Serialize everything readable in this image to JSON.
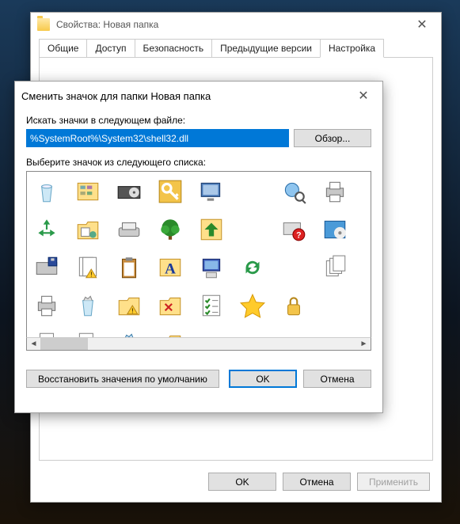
{
  "props": {
    "title": "Свойства: Новая папка",
    "tabs": [
      "Общие",
      "Доступ",
      "Безопасность",
      "Предыдущие версии",
      "Настройка"
    ],
    "active_tab": 4,
    "buttons": {
      "ok": "OK",
      "cancel": "Отмена",
      "apply": "Применить"
    }
  },
  "dlg": {
    "title": "Сменить значок для папки Новая папка",
    "path_label": "Искать значки в следующем файле:",
    "path_value": "%SystemRoot%\\System32\\shell32.dll",
    "browse": "Обзор...",
    "list_label": "Выберите значок из следующего списка:",
    "buttons": {
      "restore": "Восстановить значения по умолчанию",
      "ok": "OK",
      "cancel": "Отмена"
    }
  },
  "icons": [
    "recycle-bin-empty",
    "control-panel",
    "cd-drive",
    "key",
    "display-settings",
    "blank",
    "network-search",
    "printer",
    "recycle-arrows",
    "setup-folder",
    "scanner",
    "tree",
    "arrow-up",
    "blank",
    "help-settings",
    "programs-disc",
    "floppy-drive",
    "document-warning",
    "clipboard",
    "font-a",
    "computer-desktop",
    "refresh-arrows",
    "blank",
    "documents-stack",
    "printer2",
    "recycle-bin-full",
    "folder-warning",
    "tools-folder",
    "checklist",
    "star-favorite",
    "lock",
    "blank",
    "search-document",
    "install",
    "recycle-full-blue",
    "paint-folder"
  ]
}
